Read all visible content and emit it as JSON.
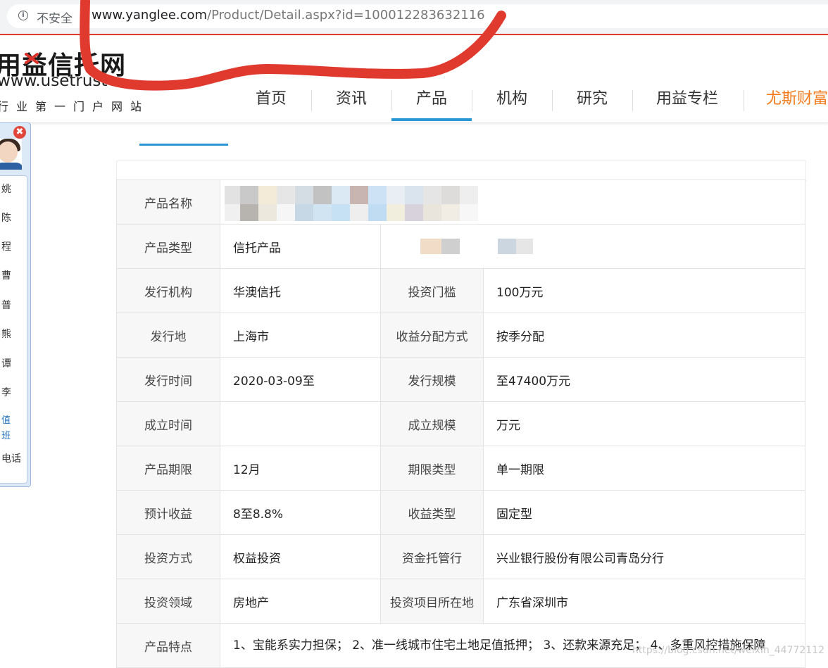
{
  "browser": {
    "security_label": "不安全",
    "url_host": "www.yanglee.com",
    "url_path": "/Product/Detail.aspx?id=100012283632116"
  },
  "site": {
    "logo_text": "用益信托网",
    "logo_domain": "www.usetrust",
    "logo_slogan": "行业第一门户网站"
  },
  "nav": {
    "items": [
      "首页",
      "资讯",
      "产品",
      "机构",
      "研究",
      "用益专栏",
      "尤斯财富"
    ],
    "active": "产品"
  },
  "service_panel": {
    "names": [
      "姚",
      "陈",
      "程",
      "曹",
      "普",
      "熊",
      "谭",
      "李"
    ],
    "links": [
      "值",
      "班"
    ],
    "phone_label": "电话",
    "close_symbol": "✖"
  },
  "detail_table": {
    "rows": [
      {
        "label1": "产品名称",
        "value1": "",
        "label2": "",
        "value2": ""
      },
      {
        "label1": "产品类型",
        "value1": "信托产品",
        "label2": "",
        "value2": ""
      },
      {
        "label1": "发行机构",
        "value1": "华澳信托",
        "label2": "投资门槛",
        "value2": "100万元"
      },
      {
        "label1": "发行地",
        "value1": "上海市",
        "label2": "收益分配方式",
        "value2": "按季分配"
      },
      {
        "label1": "发行时间",
        "value1": "2020-03-09至",
        "label2": "发行规模",
        "value2": "至47400万元"
      },
      {
        "label1": "成立时间",
        "value1": "",
        "label2": "成立规模",
        "value2": "万元"
      },
      {
        "label1": "产品期限",
        "value1": "12月",
        "label2": "期限类型",
        "value2": "单一期限"
      },
      {
        "label1": "预计收益",
        "value1": "8至8.8%",
        "label2": "收益类型",
        "value2": "固定型"
      },
      {
        "label1": "投资方式",
        "value1": "权益投资",
        "label2": "资金托管行",
        "value2": "兴业银行股份有限公司青岛分行"
      },
      {
        "label1": "投资领域",
        "value1": "房地产",
        "label2": "投资项目所在地",
        "value2": "广东省深圳市"
      }
    ],
    "feature_label": "产品特点",
    "feature_text": "1、宝能系实力担保； 2、准一线城市住宅土地足值抵押； 3、还款来源充足； 4、多重风控措施保障"
  },
  "watermark": "https://blog.csdn.net/weixin_44772112",
  "colors": {
    "accent_blue": "#2a96d4",
    "nav_orange": "#f27a1a",
    "marker_red": "#e03a2f",
    "label_bg": "#f7f7f7"
  }
}
